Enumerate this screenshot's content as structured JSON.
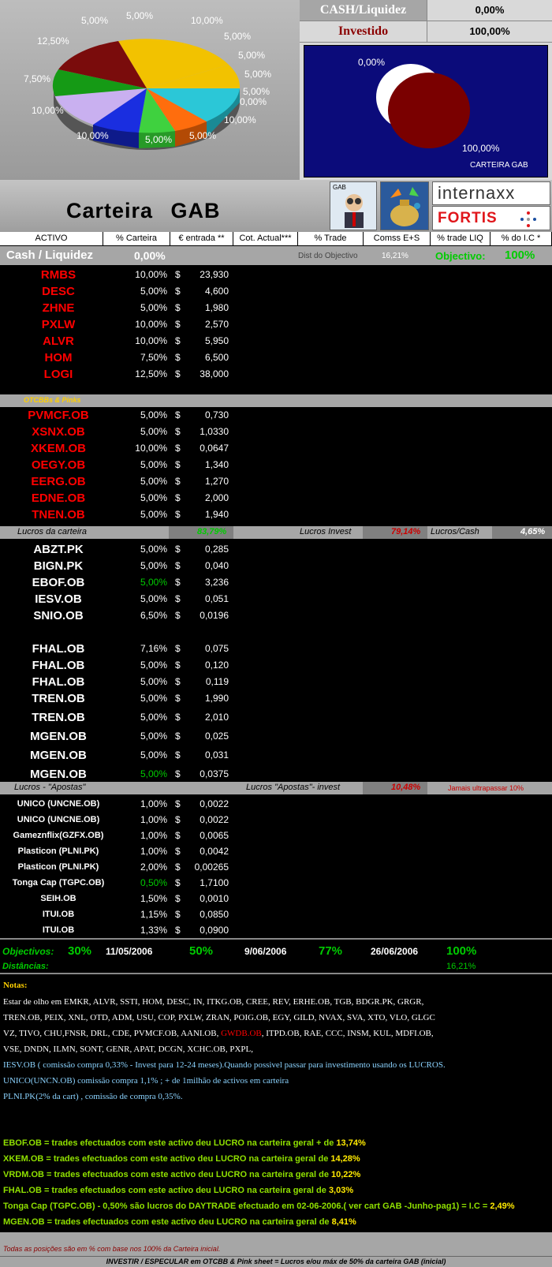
{
  "pie": {
    "labels": [
      "5,00%",
      "5,00%",
      "10,00%",
      "5,00%",
      "5,00%",
      "5,00%",
      "5,00%",
      "0,00%",
      "10,00%",
      "5,00%",
      "5,00%",
      "10,00%",
      "10,00%",
      "7,50%",
      "12,50%"
    ],
    "colors": {
      "gold": "#f2c200",
      "maroon": "#7a0c0c",
      "green": "#159a15",
      "lilac": "#c9b0f0",
      "blue": "#1a2ee0",
      "lime": "#3fd13f",
      "orange": "#ff6d0d",
      "cyan": "#2bc7d7"
    }
  },
  "kpi": {
    "cash_label": "CASH/Liquidez",
    "cash_value": "0,00%",
    "invest_label": "Investido",
    "invest_value": "100,00%"
  },
  "mini_chart": {
    "label_cash": "0,00%",
    "label_invest": "100,00%",
    "caption": "CARTEIRA GAB"
  },
  "banner": {
    "title": "Carteira GAB",
    "logo_internaxx": "internaxx",
    "logo_fortis": "FORTIS",
    "logo_gab": "GAB"
  },
  "headers": [
    "ACTIVO",
    "% Carteira",
    "€ entrada **",
    "Cot. Actual***",
    "% Trade",
    "Comss E+S",
    "% trade LIQ",
    "% do I.C *"
  ],
  "cash_row": {
    "label": "Cash / Liquidez",
    "value": "0,00%",
    "dist_label": "Dist do Objectivo",
    "dist_value": "16,21%",
    "obj_label": "Objectivo:",
    "obj_value": "100%"
  },
  "main": [
    {
      "t": "RMBS",
      "p": "10,00%",
      "d": "$",
      "e": "23,930"
    },
    {
      "t": "DESC",
      "p": "5,00%",
      "d": "$",
      "e": "4,600"
    },
    {
      "t": "ZHNE",
      "p": "5,00%",
      "d": "$",
      "e": "1,980"
    },
    {
      "t": "PXLW",
      "p": "10,00%",
      "d": "$",
      "e": "2,570"
    },
    {
      "t": "ALVR",
      "p": "10,00%",
      "d": "$",
      "e": "5,950"
    },
    {
      "t": "HOM",
      "p": "7,50%",
      "d": "$",
      "e": "6,500"
    },
    {
      "t": "LOGI",
      "p": "12,50%",
      "d": "$",
      "e": "38,000"
    }
  ],
  "otc_label": "OTCBBs & Pinks",
  "otc": [
    {
      "t": "PVMCF.OB",
      "p": "5,00%",
      "d": "$",
      "e": "0,730"
    },
    {
      "t": "XSNX.OB",
      "p": "5,00%",
      "d": "$",
      "e": "1,0330"
    },
    {
      "t": "XKEM.OB",
      "p": "10,00%",
      "d": "$",
      "e": "0,0647"
    },
    {
      "t": "OEGY.OB",
      "p": "5,00%",
      "d": "$",
      "e": "1,340"
    },
    {
      "t": "EERG.OB",
      "p": "5,00%",
      "d": "$",
      "e": "1,270"
    },
    {
      "t": "EDNE.OB",
      "p": "5,00%",
      "d": "$",
      "e": "2,000"
    },
    {
      "t": "TNEN.OB",
      "p": "5,00%",
      "d": "$",
      "e": "1,940"
    }
  ],
  "lucros": {
    "label": "Lucros da carteira",
    "value": "83,79%",
    "invest_label": "Lucros Invest",
    "invest_value": "79,14%",
    "cash_label": "Lucros/Cash",
    "cash_value": "4,65%"
  },
  "lucros_rows": [
    {
      "t": "ABZT.PK",
      "p": "5,00%",
      "d": "$",
      "e": "0,285"
    },
    {
      "t": "BIGN.PK",
      "p": "5,00%",
      "d": "$",
      "e": "0,040"
    },
    {
      "t": "EBOF.OB",
      "p": "5,00%",
      "d": "$",
      "e": "3,236"
    },
    {
      "t": "IESV.OB",
      "p": "5,00%",
      "d": "$",
      "e": "0,051"
    },
    {
      "t": "SNIO.OB",
      "p": "6,50%",
      "d": "$",
      "e": "0,0196"
    },
    {
      "t": "FHAL.OB",
      "p": "7,16%",
      "d": "$",
      "e": "0,075"
    },
    {
      "t": "FHAL.OB",
      "p": "5,00%",
      "d": "$",
      "e": "0,120"
    },
    {
      "t": "FHAL.OB",
      "p": "5,00%",
      "d": "$",
      "e": "0,119"
    },
    {
      "t": "TREN.OB",
      "p": "5,00%",
      "d": "$",
      "e": "1,990"
    },
    {
      "t": "TREN.OB",
      "p": "5,00%",
      "d": "$",
      "e": "2,010"
    },
    {
      "t": "MGEN.OB",
      "p": "5,00%",
      "d": "$",
      "e": "0,025"
    },
    {
      "t": "MGEN.OB",
      "p": "5,00%",
      "d": "$",
      "e": "0,031"
    },
    {
      "t": "MGEN.OB",
      "p": "5,00%",
      "d": "$",
      "e": "0,0375"
    }
  ],
  "apostas": {
    "label": "Lucros - \"Apostas\"",
    "invest_label": "Lucros \"Apostas\"- invest",
    "invest_value": "10,48%",
    "warning": "Jamais ultrapassar 10%"
  },
  "apostas_rows": [
    {
      "t": "UNICO (UNCNE.OB)",
      "p": "1,00%",
      "d": "$",
      "e": "0,0022"
    },
    {
      "t": "UNICO (UNCNE.OB)",
      "p": "1,00%",
      "d": "$",
      "e": "0,0022"
    },
    {
      "t": "Gameznflix(GZFX.OB)",
      "p": "1,00%",
      "d": "$",
      "e": "0,0065"
    },
    {
      "t": "Plasticon (PLNI.PK)",
      "p": "1,00%",
      "d": "$",
      "e": "0,0042"
    },
    {
      "t": "Plasticon (PLNI.PK)",
      "p": "2,00%",
      "d": "$",
      "e": "0,00265"
    },
    {
      "t": "Tonga Cap (TGPC.OB)",
      "p": "0,50%",
      "d": "$",
      "e": "1,7100"
    },
    {
      "t": "SEIH.OB",
      "p": "1,50%",
      "d": "$",
      "e": "0,0010"
    },
    {
      "t": "ITUI.OB",
      "p": "1,15%",
      "d": "$",
      "e": "0,0850"
    },
    {
      "t": "ITUI.OB",
      "p": "1,33%",
      "d": "$",
      "e": "0,0900"
    }
  ],
  "objectivos": {
    "label": "Objectivos:",
    "o1": "30%",
    "d1": "11/05/2006",
    "o2": "50%",
    "d2": "9/06/2006",
    "o3": "77%",
    "d3": "26/06/2006",
    "o4": "100%",
    "dist_label": "Distâncias:",
    "dist_value": "16,21%"
  },
  "notas": {
    "title": "Notas:",
    "l1": "Estar de olho em  EMKR, ALVR, SSTI, HOM, DESC, IN, ITKG.OB, CREE, REV, ERHE.OB, TGB, BDGR.PK, GRGR,",
    "l2": "TREN.OB, PEIX, XNL, OTD, ADM, USU, COP, PXLW, ZRAN, POIG.OB, EGY, GILD, NVAX, SVA, XTO, VLO, GLGC",
    "l3a": "VZ, TIVO, CHU,FNSR, DRL, CDE, PVMCF.OB, AANI.OB, ",
    "l3b": "GWDB.OB",
    "l3c": ", ITPD.OB, RAE, CCC, INSM, KUL, MDFI.OB,",
    "l4": "VSE, DNDN, ILMN, SONT, GENR, APAT, DCGN, XCHC.OB, PXPL,",
    "l5": "IESV.OB ( comissão compra 0,33% - Invest para 12-24 meses).Quando possivel passar para investimento  usando os LUCROS.",
    "l6": "UNICO(UNCN.OB) comissão compra 1,1% ; + de 1milhão de activos em carteira",
    "l7": "PLNI.PK(2% da cart) , comissão de compra 0,35%."
  },
  "trades": [
    {
      "txt": "EBOF.OB = trades efectuados com este activo  deu LUCRO na carteira geral + de ",
      "v": "13,74%"
    },
    {
      "txt": "XKEM.OB = trades efectuados com este activo  deu LUCRO na carteira geral de ",
      "v": "14,28%"
    },
    {
      "txt": "VRDM.OB = trades efectuados com este activo  deu LUCRO na carteira geral de ",
      "v": "10,22%"
    },
    {
      "txt": "FHAL.OB = trades efectuados com este activo  deu LUCRO na carteira geral de ",
      "v": "3,03%"
    },
    {
      "txt": "Tonga Cap (TGPC.OB) -  0,50% são lucros  do DAYTRADE efectuado em 02-06-2006.( ver cart GAB -Junho-pag1) = I.C = ",
      "v": "2,49%"
    },
    {
      "txt": "MGEN.OB = trades efectuados com este activo  deu LUCRO na carteira geral de ",
      "v": "8,41%"
    }
  ],
  "footer": {
    "note": "Todas as posições são em % com base nos 100% da Carteira inicial.",
    "bottom": "INVESTIR / ESPECULAR em OTCBB & Pink sheet  = Lucros e/ou máx de 50% da carteira GAB (inicial)"
  }
}
